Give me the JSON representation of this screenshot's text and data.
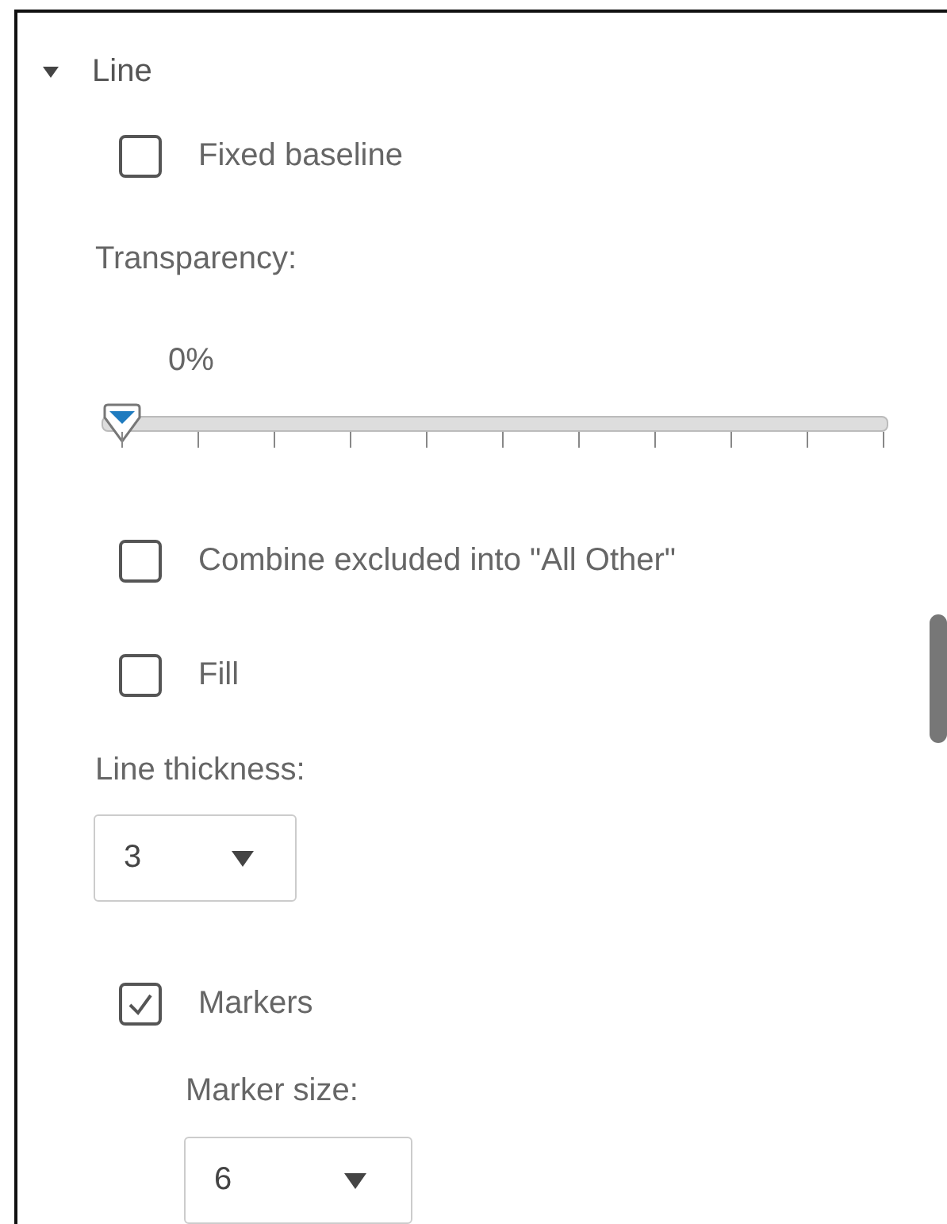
{
  "section": {
    "title": "Line",
    "expanded": true
  },
  "fixed_baseline": {
    "label": "Fixed baseline",
    "checked": false
  },
  "transparency": {
    "label": "Transparency:",
    "reading": "0%",
    "level": 0
  },
  "options": [
    {
      "label": "Combine excluded into \"All Other\"",
      "checked": false
    },
    {
      "label": "Fill",
      "checked": false
    }
  ],
  "line_thickness": {
    "label": "Line thickness:",
    "value": "3"
  },
  "markers": {
    "label": "Markers",
    "checked": true,
    "size_label": "Marker size:",
    "size_value": "6"
  }
}
